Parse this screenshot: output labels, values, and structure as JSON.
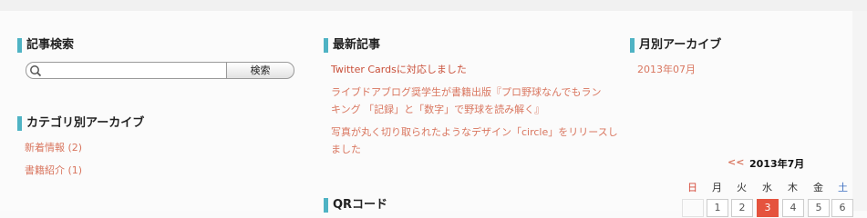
{
  "search": {
    "heading": "記事検索",
    "button_label": "検索",
    "value": ""
  },
  "categories": {
    "heading": "カテゴリ別アーカイブ",
    "items": [
      "新着情報 (2)",
      "書籍紹介 (1)"
    ]
  },
  "recent": {
    "heading": "最新記事",
    "items": [
      {
        "line1": "Twitter Cardsに対応しました"
      },
      {
        "line1": "ライブドアブログ奨学生が書籍出版『プロ野球なんでもラン",
        "line2": "キング 「記録」と「数字」で野球を読み解く』"
      },
      {
        "line1": "写真が丸く切り取られたようなデザイン「circle」をリリースし",
        "line2": "ました"
      }
    ]
  },
  "qr": {
    "heading": "QRコード"
  },
  "archive": {
    "heading": "月別アーカイブ",
    "items": [
      "2013年07月"
    ]
  },
  "calendar": {
    "prev": "<<",
    "title": "2013年7月",
    "weekdays": [
      "日",
      "月",
      "火",
      "水",
      "木",
      "金",
      "土"
    ],
    "first_row": [
      "",
      "1",
      "2",
      "3",
      "4",
      "5",
      "6"
    ],
    "today": "3",
    "colors": {
      "sunday": "#d64a3a",
      "saturday": "#3d6fc0",
      "today": "#e5533e"
    }
  },
  "colors": {
    "accent": "#4fb3c4",
    "link": "#d9765f"
  }
}
